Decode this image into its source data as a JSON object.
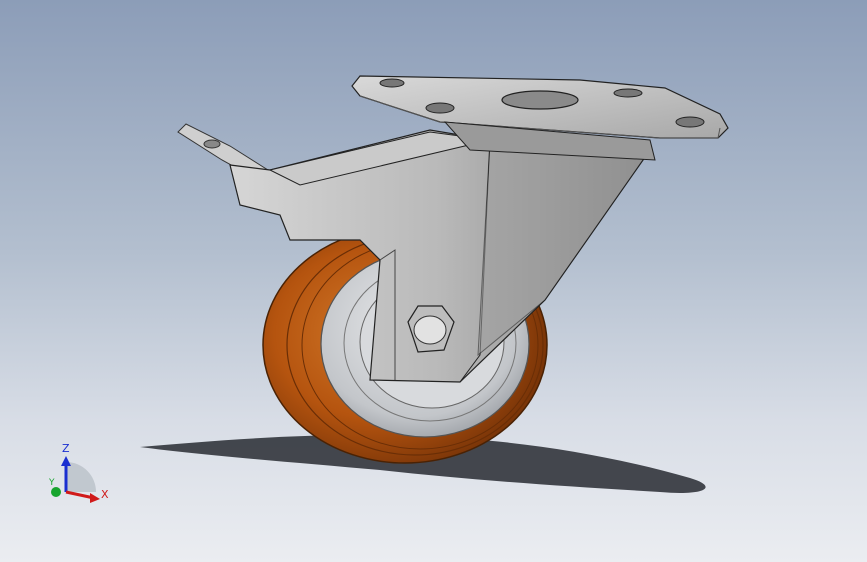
{
  "viewport": {
    "model_name": "swivel-caster-with-brake",
    "colors": {
      "background_top": "#8c9db8",
      "background_bottom": "#ebedf1",
      "tread": "#b5540f",
      "hub": "#c9cbce",
      "steel": "#b8b8b8",
      "shadow": "#3a3d44"
    }
  },
  "triad": {
    "z_label": "Z",
    "x_label": "X",
    "y_label": "Y",
    "colors": {
      "z": "#1a2fd0",
      "x": "#d01a1a",
      "y": "#17a52e"
    }
  }
}
